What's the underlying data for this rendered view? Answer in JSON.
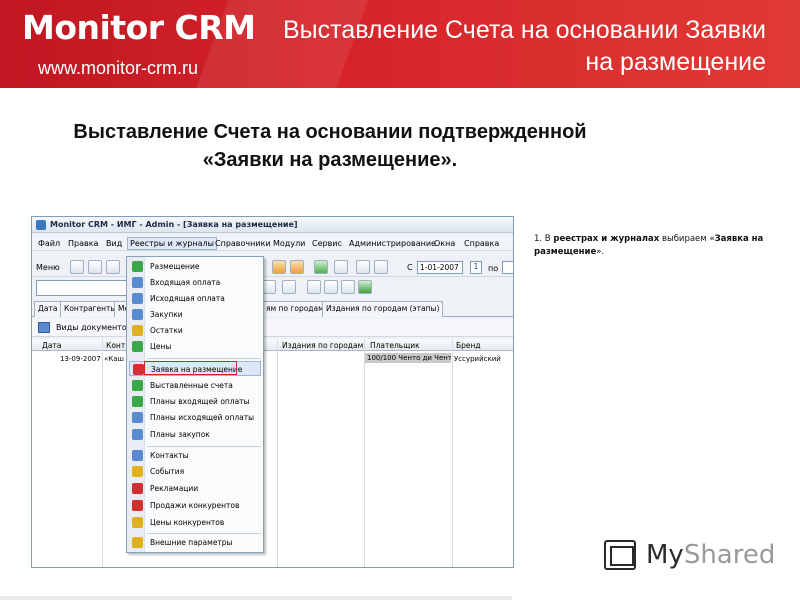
{
  "header": {
    "logo": "Monitor CRM",
    "site": "www.monitor-crm.ru",
    "title_line1": "Выставление Счета на основании Заявки",
    "title_line2": "на размещение"
  },
  "slide": {
    "title_line1": "Выставление Счета на основании подтвержденной",
    "title_line2": "«Заявки на размещение»."
  },
  "window": {
    "title": "Monitor CRM - ИМГ - Admin - [Заявка на размещение]",
    "menu": [
      "Файл",
      "Правка",
      "Вид",
      "Реестры и журналы",
      "Справочники",
      "Модули",
      "Сервис",
      "Администрирование",
      "Окна",
      "Справка"
    ],
    "toolbar": {
      "menu_label": "Меню",
      "from_label": "С",
      "date_from": "1-01-2007",
      "num": "1",
      "to_label": "по"
    },
    "tabs": [
      "Дата",
      "Контрагенты",
      "Ме",
      "ям по городам",
      "Издания по городам (этапы)"
    ],
    "docs_label": "Виды документов -",
    "grid": {
      "headers": [
        "Дата",
        "Конт",
        "Издания по городам",
        "Плательщик",
        "Бренд"
      ],
      "row": {
        "date": "13-09-2007",
        "contr": "«Каш",
        "payer": "100/100 Ченто ди Чент",
        "brand": "Уссурийский"
      }
    }
  },
  "dropdown": {
    "group1": [
      "Размещение",
      "Входящая оплата",
      "Исходящая оплата",
      "Закупки",
      "Остатки",
      "Цены"
    ],
    "group2": [
      "Заявка на размещение",
      "Выставленные счета",
      "Планы входящей оплаты",
      "Планы исходящей оплаты",
      "Планы закупок"
    ],
    "group3": [
      "Контакты",
      "События",
      "Рекламации",
      "Продажи конкурентов",
      "Цены конкурентов"
    ],
    "group4": [
      "Внешние параметры"
    ],
    "highlighted": "Заявка на размещение",
    "icon_colors": {
      "default": "#5a8ad0",
      "green": "#3aa84a",
      "yellow": "#e0b020",
      "red": "#d03030"
    }
  },
  "note": {
    "prefix": "1. В ",
    "bold1": "реестрах и журналах",
    "middle": " выбираем «",
    "bold2": "Заявка на размещение",
    "suffix": "»."
  },
  "watermark": {
    "my": "My",
    "shared": "Shared"
  },
  "colors": {
    "brand_red": "#d52329",
    "highlight_box": "#d8202a"
  }
}
